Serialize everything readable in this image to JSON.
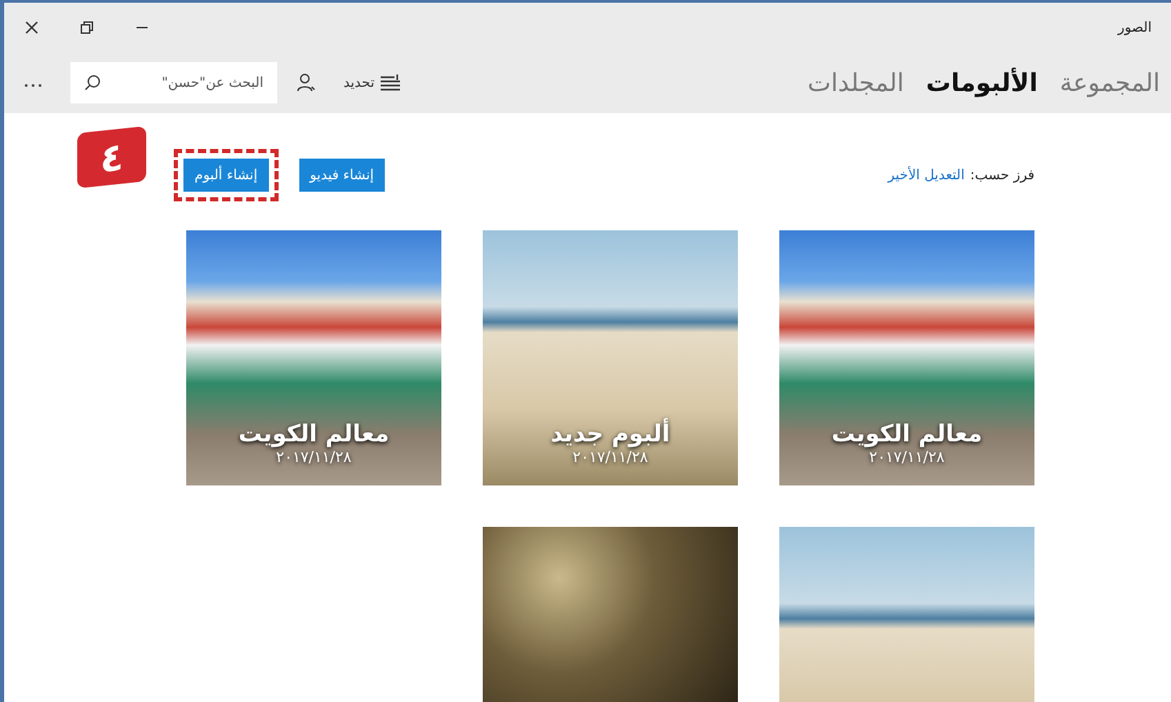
{
  "window": {
    "title": "الصور"
  },
  "tabs": [
    {
      "label": "المجموعة",
      "selected": false
    },
    {
      "label": "الألبومات",
      "selected": true
    },
    {
      "label": "المجلدات",
      "selected": false
    }
  ],
  "toolbar": {
    "select_label": "تحديد",
    "search": {
      "placeholder": "البحث عن\"حسن\""
    }
  },
  "sort": {
    "label": "فرز حسب:",
    "value": "التعديل الأخير"
  },
  "buttons": [
    {
      "label": "إنشاء فيديو",
      "highlighted": false
    },
    {
      "label": "إنشاء ألبوم",
      "highlighted": true
    }
  ],
  "step_badge": "٤",
  "albums": [
    {
      "kind": "park",
      "title": "معالم الكويت",
      "date": "٢٠١٧/١١/٢٨"
    },
    {
      "kind": "mosque",
      "title": "ألبوم جديد",
      "date": "٢٠١٧/١١/٢٨"
    },
    {
      "kind": "park",
      "title": "معالم الكويت",
      "date": "٢٠١٧/١١/٢٨"
    },
    {
      "kind": "mosque"
    },
    {
      "kind": "sparkle"
    }
  ]
}
